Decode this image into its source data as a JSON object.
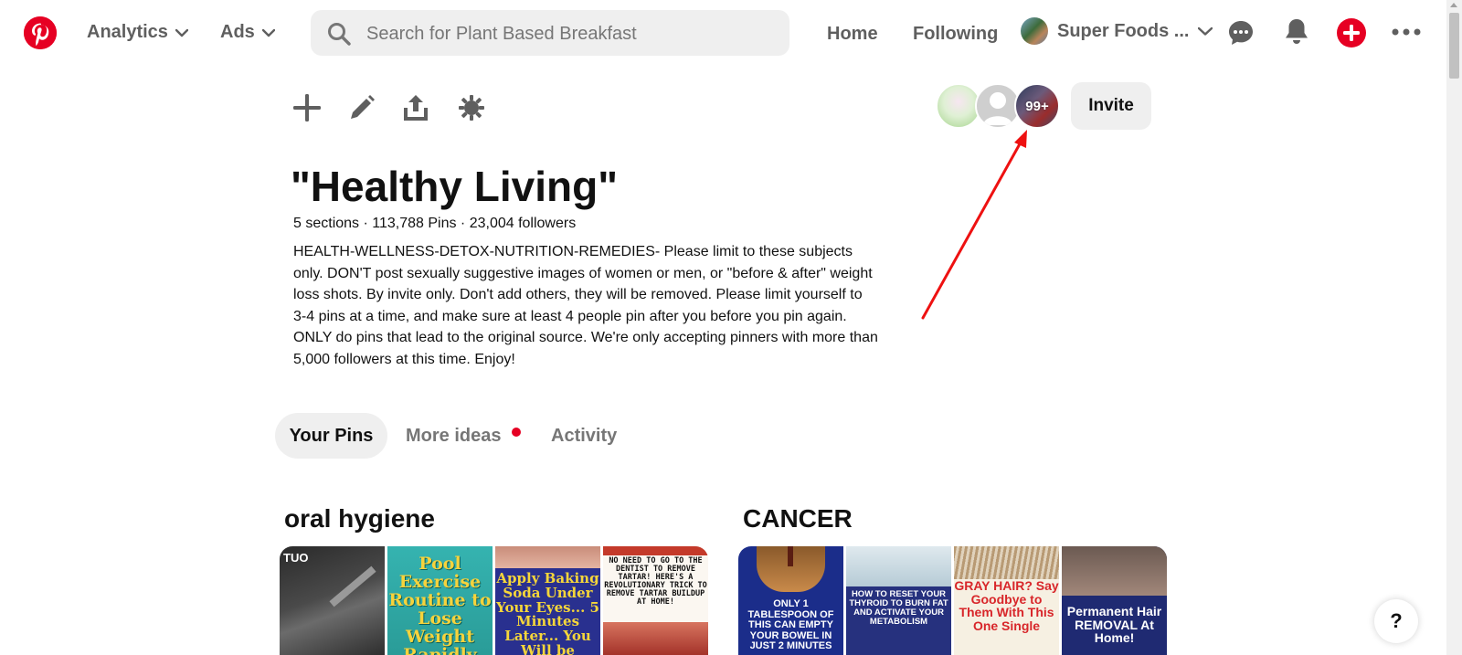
{
  "header": {
    "nav_analytics": "Analytics",
    "nav_ads": "Ads",
    "search_placeholder": "Search for Plant Based Breakfast",
    "home": "Home",
    "following": "Following",
    "profile_name": "Super Foods ...",
    "icons": [
      "pinterest-logo",
      "search-icon",
      "chevron-down-icon",
      "messages-icon",
      "bell-icon",
      "plus-icon",
      "more-icon"
    ],
    "brand_color": "#e60023"
  },
  "board": {
    "actions": [
      "add-icon",
      "edit-icon",
      "share-icon",
      "settings-icon"
    ],
    "collaborators_overflow": "99+",
    "invite_label": "Invite",
    "title": "\"Healthy Living\"",
    "meta": "5 sections · 113,788 Pins · 23,004 followers",
    "description": "HEALTH-WELLNESS-DETOX-NUTRITION-REMEDIES- Please limit to these subjects only. DON'T post sexually suggestive images of women or men, or \"before & after\" weight loss shots. By invite only. Don't add others, they will be removed. Please limit yourself to 3-4 pins at a time, and make sure at least 4 people pin after you before you pin again. ONLY do pins that lead to the original source. We're only accepting pinners with more than 5,000 followers at this time. Enjoy!"
  },
  "tabs": {
    "your_pins": "Your Pins",
    "more_ideas": "More ideas",
    "activity": "Activity"
  },
  "sections": [
    {
      "title": "oral hygiene",
      "pins": [
        {
          "text": "TUO"
        },
        {
          "text": "Pool Exercise Routine to Lose Weight Rapidly"
        },
        {
          "text": "Apply Baking Soda Under Your Eyes... 5 Minutes Later... You Will be Amazed!"
        },
        {
          "text": "NO NEED TO GO TO THE DENTIST TO REMOVE TARTAR! HERE'S A REVOLUTIONARY TRICK TO REMOVE TARTAR BUILDUP AT HOME!"
        }
      ]
    },
    {
      "title": "CANCER",
      "pins": [
        {
          "text": "ONLY 1 TABLESPOON OF THIS CAN EMPTY YOUR BOWEL IN JUST 2 MINUTES"
        },
        {
          "text": "HOW TO RESET YOUR THYROID TO BURN FAT AND ACTIVATE YOUR METABOLISM"
        },
        {
          "text": "GRAY HAIR? Say Goodbye to Them With This One Single"
        },
        {
          "text": "Permanent Hair REMOVAL At Home!"
        }
      ]
    }
  ],
  "help_label": "?"
}
